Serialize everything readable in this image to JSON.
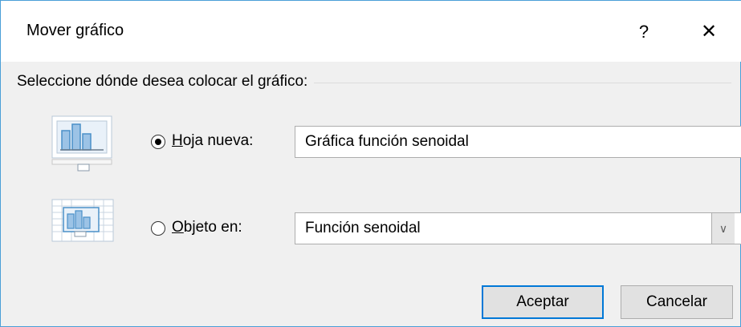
{
  "dialog": {
    "title": "Mover gráfico",
    "help_label": "?",
    "close_label": "✕"
  },
  "group": {
    "label": "Seleccione dónde desea colocar el gráfico:"
  },
  "options": {
    "new_sheet": {
      "accel": "H",
      "label_rest": "oja nueva:",
      "selected": true,
      "value": "Gráfica función senoidal"
    },
    "object_in": {
      "accel": "O",
      "label_rest": "bjeto en:",
      "selected": false,
      "value": "Función senoidal"
    }
  },
  "buttons": {
    "ok": "Aceptar",
    "cancel": "Cancelar"
  },
  "colors": {
    "accent": "#0078d7",
    "chart_bar": "#4a90c8"
  }
}
